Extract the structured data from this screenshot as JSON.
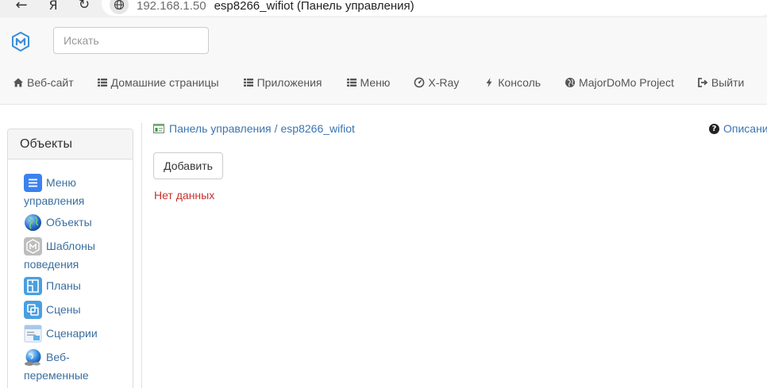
{
  "browser": {
    "back_glyph": "←",
    "yandex_glyph": "Я",
    "reload_glyph": "↻",
    "url_host": "192.168.1.50",
    "tab_title": "esp8266_wifiot (Панель управления)"
  },
  "search": {
    "placeholder": "Искать"
  },
  "nav": {
    "items": [
      {
        "label": "Веб-сайт",
        "icon": "home-icon"
      },
      {
        "label": "Домашние страницы",
        "icon": "list-icon"
      },
      {
        "label": "Приложения",
        "icon": "list-icon"
      },
      {
        "label": "Меню",
        "icon": "list-icon"
      },
      {
        "label": "X-Ray",
        "icon": "dashboard-icon"
      },
      {
        "label": "Консоль",
        "icon": "bolt-icon"
      },
      {
        "label": "MajorDoMo Project",
        "icon": "globe-icon"
      },
      {
        "label": "Выйти",
        "icon": "logout-icon"
      }
    ]
  },
  "sidebar": {
    "title": "Объекты",
    "items": [
      {
        "label": "Меню управления",
        "icon": "menu-icon"
      },
      {
        "label": "Объекты",
        "icon": "globe-icon"
      },
      {
        "label": "Шаблоны поведения",
        "icon": "template-icon"
      },
      {
        "label": "Планы",
        "icon": "plan-icon"
      },
      {
        "label": "Сцены",
        "icon": "scenes-icon"
      },
      {
        "label": "Сценарии",
        "icon": "scripts-icon"
      },
      {
        "label": "Веб-переменные",
        "icon": "web-globe-icon"
      }
    ]
  },
  "breadcrumb": {
    "root": "Панель управления",
    "separator": "/",
    "current": "esp8266_wifiot"
  },
  "help": {
    "label": "Описани"
  },
  "main": {
    "add_label": "Добавить",
    "empty_text": "Нет данных"
  },
  "colors": {
    "link": "#3a75b0",
    "error": "#c9302c",
    "navbar_bg": "#f8f8f8"
  }
}
